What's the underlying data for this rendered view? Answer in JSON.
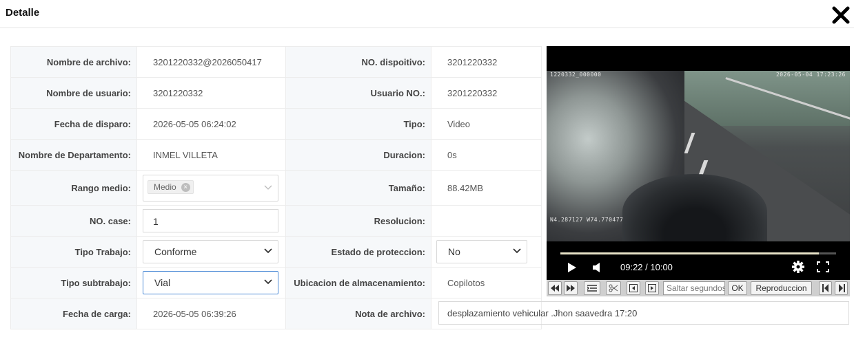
{
  "dialog": {
    "title": "Detalle"
  },
  "fields": {
    "file_name": {
      "label": "Nombre de archivo:",
      "value": "3201220332@2026050417"
    },
    "device_no": {
      "label": "NO. dispoitivo:",
      "value": "3201220332"
    },
    "user_name": {
      "label": "Nombre de usuario:",
      "value": "3201220332"
    },
    "user_no": {
      "label": "Usuario NO.:",
      "value": "3201220332"
    },
    "trigger_date": {
      "label": "Fecha de disparo:",
      "value": "2026-05-05 06:24:02"
    },
    "type": {
      "label": "Tipo:",
      "value": "Video"
    },
    "department": {
      "label": "Nombre de Departamento:",
      "value": "INMEL VILLETA"
    },
    "duration": {
      "label": "Duracion:",
      "value": "0s"
    },
    "media_range": {
      "label": "Rango medio:",
      "tag": "Medio"
    },
    "size": {
      "label": "Tamaño:",
      "value": "88.42MB"
    },
    "case_no": {
      "label": "NO. case:",
      "value": "1"
    },
    "resolution": {
      "label": "Resolucion:",
      "value": ""
    },
    "work_type": {
      "label": "Tipo Trabajo:",
      "value": "Conforme"
    },
    "protection": {
      "label": "Estado de proteccion:",
      "value": "No"
    },
    "work_subtype": {
      "label": "Tipo subtrabajo:",
      "value": "Vial"
    },
    "storage": {
      "label": "Ubicacion de almacenamiento:",
      "value": "Copilotos"
    },
    "upload_date": {
      "label": "Fecha de carga:",
      "value": "2026-05-05 06:39:26"
    },
    "note": {
      "label": "Nota de archivo:",
      "value": "desplazamiento vehicular .Jhon saavedra 17:20"
    }
  },
  "video": {
    "osd_top_left": "1220332_000000",
    "osd_top_right": "2026-05-04 17:23:26",
    "osd_coords": "N4.287127 W74.770477",
    "time_display": "09:22 / 10:00",
    "progress": 0.937
  },
  "toolbar": {
    "seek_placeholder": "Saltar segundos",
    "ok_label": "OK",
    "playback_label": "Reproduccion"
  }
}
